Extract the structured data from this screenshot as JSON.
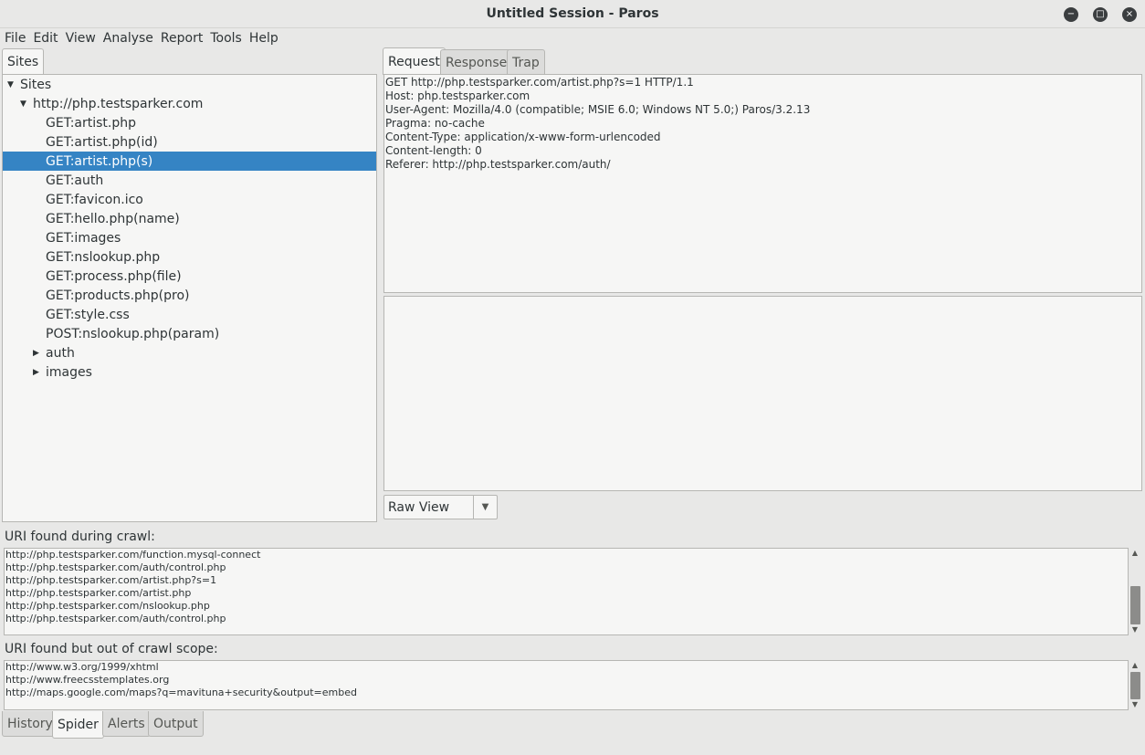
{
  "window": {
    "title": "Untitled Session - Paros",
    "minimize_glyph": "−",
    "maximize_glyph": "□",
    "close_glyph": "×"
  },
  "menu": [
    "File",
    "Edit",
    "View",
    "Analyse",
    "Report",
    "Tools",
    "Help"
  ],
  "sites_tab": "Sites",
  "tree": {
    "root": "Sites",
    "host": "http://php.testsparker.com",
    "items": [
      "GET:artist.php",
      "GET:artist.php(id)",
      "GET:artist.php(s)",
      "GET:auth",
      "GET:favicon.ico",
      "GET:hello.php(name)",
      "GET:images",
      "GET:nslookup.php",
      "GET:process.php(file)",
      "GET:products.php(pro)",
      "GET:style.css",
      "POST:nslookup.php(param)"
    ],
    "selected_index": 2,
    "folders": [
      "auth",
      "images"
    ],
    "expanded_glyph": "▼",
    "collapsed_glyph": "▶"
  },
  "right_tabs": [
    "Request",
    "Response",
    "Trap"
  ],
  "active_right_tab": "Request",
  "request_header_lines": [
    "GET http://php.testsparker.com/artist.php?s=1 HTTP/1.1",
    "Host: php.testsparker.com",
    "User-Agent: Mozilla/4.0 (compatible; MSIE 6.0; Windows NT 5.0;) Paros/3.2.13",
    "Pragma: no-cache",
    "Content-Type: application/x-www-form-urlencoded",
    "Content-length: 0",
    "Referer: http://php.testsparker.com/auth/"
  ],
  "request_body": "",
  "view_select": {
    "value": "Raw View",
    "arrow": "▼"
  },
  "spider": {
    "found_label": "URI found during crawl:",
    "found_uris": [
      "http://php.testsparker.com/function.mysql-connect",
      "http://php.testsparker.com/auth/control.php",
      "http://php.testsparker.com/artist.php?s=1",
      "http://php.testsparker.com/artist.php",
      "http://php.testsparker.com/nslookup.php",
      "http://php.testsparker.com/auth/control.php"
    ],
    "out_scope_label": "URI found but out of crawl scope:",
    "out_scope_uris": [
      "http://www.w3.org/1999/xhtml",
      "http://www.freecsstemplates.org",
      "http://maps.google.com/maps?q=mavituna+security&output=embed"
    ]
  },
  "scroll_glyphs": {
    "up": "▲",
    "down": "▼"
  },
  "bottom_tabs": [
    "History",
    "Spider",
    "Alerts",
    "Output"
  ],
  "active_bottom_tab": "Spider"
}
